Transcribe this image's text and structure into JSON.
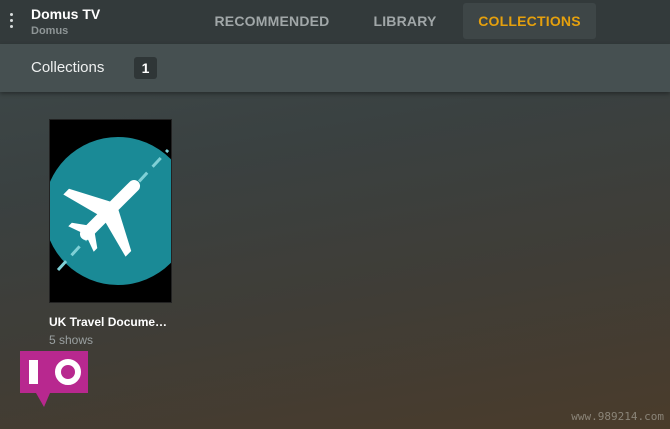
{
  "app": {
    "server_name": "Domus TV",
    "server_sub": "Domus"
  },
  "tabs": [
    {
      "label": "RECOMMENDED",
      "active": false
    },
    {
      "label": "LIBRARY",
      "active": false
    },
    {
      "label": "COLLECTIONS",
      "active": true
    }
  ],
  "subheader": {
    "title": "Collections",
    "count": "1"
  },
  "collections": [
    {
      "title": "UK Travel Docume…",
      "subtitle": "5 shows",
      "icon": "airplane-icon",
      "poster_color": "#1a8a96"
    }
  ],
  "logo": {
    "text": "IO",
    "color": "#b8288f"
  },
  "watermark": "www.989214.com",
  "colors": {
    "accent": "#e5a00d",
    "topbar": "#333a3b",
    "subheader": "#465051"
  }
}
